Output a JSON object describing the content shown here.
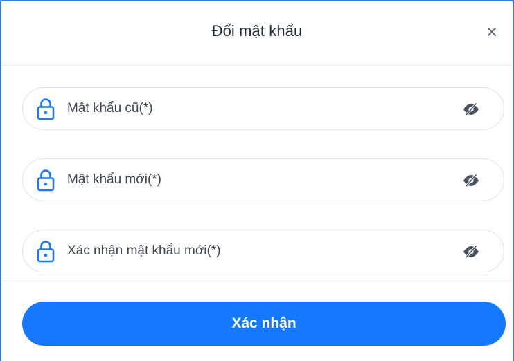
{
  "dialog": {
    "title": "Đổi mật khẩu",
    "close_icon": "close-icon"
  },
  "fields": [
    {
      "placeholder": "Mật khẩu cũ(*)",
      "value": "",
      "lead_icon": "lock-icon",
      "trail_icon": "eye-off-icon"
    },
    {
      "placeholder": "Mật khẩu mới(*)",
      "value": "",
      "lead_icon": "lock-icon",
      "trail_icon": "eye-off-icon"
    },
    {
      "placeholder": "Xác nhận mật khẩu mới(*)",
      "value": "",
      "lead_icon": "lock-icon",
      "trail_icon": "eye-off-icon"
    }
  ],
  "submit": {
    "label": "Xác nhận"
  },
  "colors": {
    "accent": "#1677ff",
    "frame_border": "#3a7bd5",
    "field_border": "#dfe3e8",
    "text": "#1f2a37"
  }
}
